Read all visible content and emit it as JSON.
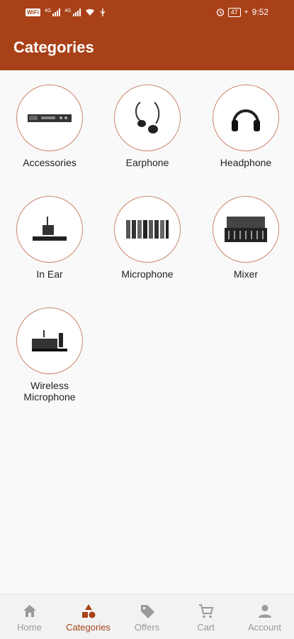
{
  "status_bar": {
    "wifi_tag": "WiFi",
    "signal_label_1": "4G",
    "signal_label_2": "4G",
    "battery": "47",
    "time": "9:52"
  },
  "header": {
    "title": "Categories"
  },
  "categories": [
    {
      "label": "Accessories",
      "icon": "rack-unit-icon"
    },
    {
      "label": "Earphone",
      "icon": "earphone-icon"
    },
    {
      "label": "Headphone",
      "icon": "headphone-icon"
    },
    {
      "label": "In Ear",
      "icon": "in-ear-monitor-icon"
    },
    {
      "label": "Microphone",
      "icon": "microphone-icon"
    },
    {
      "label": "Mixer",
      "icon": "mixer-icon"
    },
    {
      "label": "Wireless Microphone",
      "icon": "wireless-mic-icon"
    }
  ],
  "bottom_nav": [
    {
      "label": "Home",
      "icon": "home-icon",
      "active": false
    },
    {
      "label": "Categories",
      "icon": "categories-icon",
      "active": true
    },
    {
      "label": "Offers",
      "icon": "tag-icon",
      "active": false
    },
    {
      "label": "Cart",
      "icon": "cart-icon",
      "active": false
    },
    {
      "label": "Account",
      "icon": "account-icon",
      "active": false
    }
  ],
  "colors": {
    "accent": "#a84118",
    "inactive": "#9a9a9a",
    "background": "#f9f9f9"
  }
}
